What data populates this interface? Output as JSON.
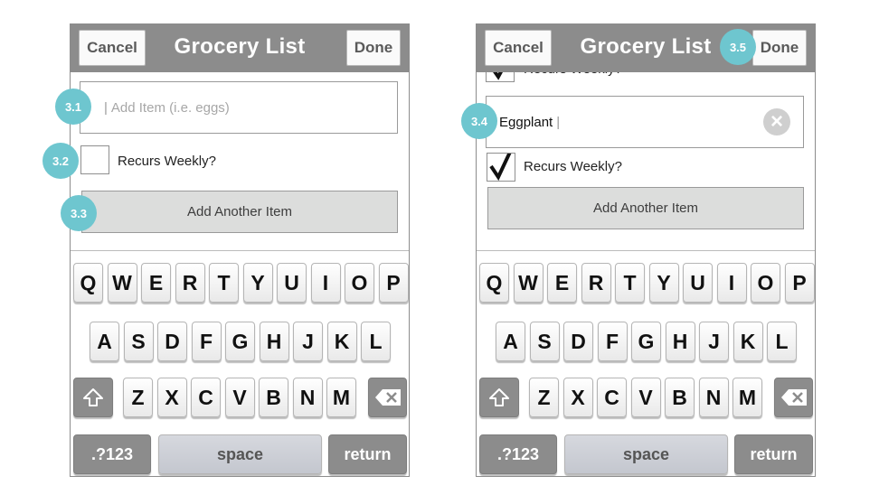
{
  "screens": [
    {
      "nav": {
        "cancel": "Cancel",
        "title": "Grocery List",
        "done": "Done"
      },
      "item_input": {
        "prefix": "|",
        "placeholder": "Add Item (i.e. eggs)"
      },
      "recurs_label": "Recurs Weekly?",
      "recurs_checked": false,
      "add_another": "Add Another Item",
      "badges": [
        "3.1",
        "3.2",
        "3.3"
      ]
    },
    {
      "nav": {
        "cancel": "Cancel",
        "title": "Grocery List",
        "done": "Done"
      },
      "partial_label": "Recurs Weekly?",
      "item_input": {
        "value": "Eggplant",
        "cursor": "|"
      },
      "recurs_label": "Recurs Weekly?",
      "recurs_checked": true,
      "add_another": "Add Another Item",
      "badges": [
        "3.4",
        "3.5"
      ]
    }
  ],
  "keyboard": {
    "row1": [
      "Q",
      "W",
      "E",
      "R",
      "T",
      "Y",
      "U",
      "I",
      "O",
      "P"
    ],
    "row2": [
      "A",
      "S",
      "D",
      "F",
      "G",
      "H",
      "J",
      "K",
      "L"
    ],
    "row3": [
      "Z",
      "X",
      "C",
      "V",
      "B",
      "N",
      "M"
    ],
    "numbers": ".?123",
    "space": "space",
    "return": "return"
  },
  "colors": {
    "nav_bar": "#8c8c8c",
    "badge": "#6ec6cf",
    "button_fill": "#dcdddc"
  },
  "icons": [
    "shift-icon",
    "backspace-icon",
    "clear-icon",
    "checkmark-icon"
  ]
}
